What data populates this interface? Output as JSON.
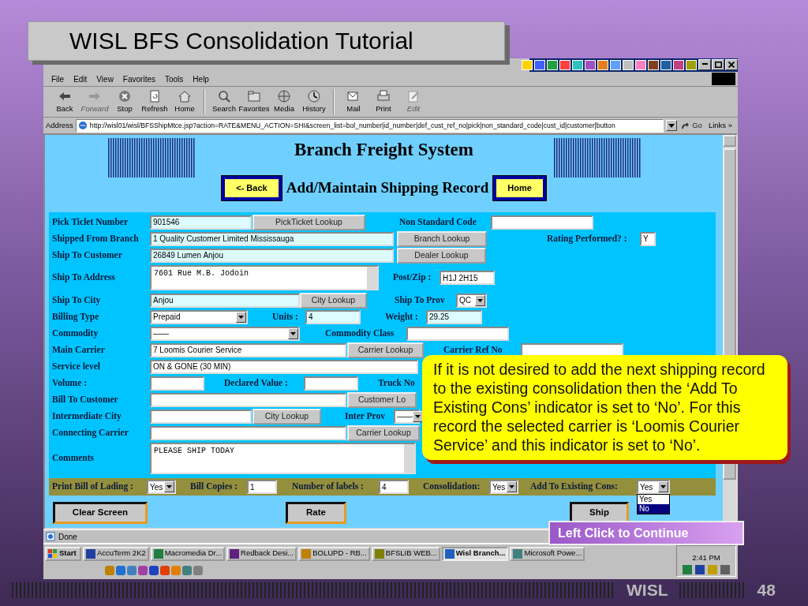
{
  "slide": {
    "title": "WISL BFS Consolidation Tutorial",
    "brand": "WISL",
    "page_number": "48"
  },
  "browser": {
    "menu": [
      "File",
      "Edit",
      "View",
      "Favorites",
      "Tools",
      "Help"
    ],
    "toolbar": [
      {
        "label": "Back",
        "disabled": false
      },
      {
        "label": "Forward",
        "disabled": true
      },
      {
        "label": "Stop",
        "disabled": false
      },
      {
        "label": "Refresh",
        "disabled": false
      },
      {
        "label": "Home",
        "disabled": false
      },
      {
        "label": "Search",
        "disabled": false
      },
      {
        "label": "Favorites",
        "disabled": false
      },
      {
        "label": "Media",
        "disabled": false
      },
      {
        "label": "History",
        "disabled": false
      },
      {
        "label": "Mail",
        "disabled": false
      },
      {
        "label": "Print",
        "disabled": false
      },
      {
        "label": "Edit",
        "disabled": true
      }
    ],
    "address_label": "Address",
    "url": "http://wisl01/wisl/BFSShipMtce.jsp?action=RATE&MENU_ACTION=SHI&screen_list=bol_number|id_number|def_cust_ref_no|pick|non_standard_code|cust_id|customer|button",
    "go": "Go",
    "links": "Links »",
    "status": "Done"
  },
  "page": {
    "title": "Branch Freight System",
    "subtitle": "Add/Maintain Shipping Record",
    "back": "<- Back",
    "home": "Home",
    "rows": [
      {
        "items": [
          {
            "kind": "label",
            "text": "Pick Ticlet Number"
          },
          {
            "kind": "input",
            "value": "901546",
            "readonly": true
          },
          {
            "kind": "button",
            "text": "PickTicket Lookup"
          },
          {
            "kind": "label",
            "text": "Non Standard Code"
          },
          {
            "kind": "input",
            "readonly": false
          }
        ]
      },
      {
        "items": [
          {
            "kind": "label",
            "text": "Shipped From Branch"
          },
          {
            "kind": "input",
            "value": "1 Quality Customer Limited Mississauga",
            "readonly": true
          },
          {
            "kind": "button",
            "text": "Branch Lookup"
          },
          {
            "kind": "label",
            "text": "Rating Performed? :"
          },
          {
            "kind": "input",
            "value": "Y",
            "readonly": false
          }
        ]
      },
      {
        "items": [
          {
            "kind": "label",
            "text": "Ship To Customer"
          },
          {
            "kind": "input",
            "value": "26849 Lumen Anjou",
            "readonly": true
          },
          {
            "kind": "button",
            "text": "Dealer Lookup"
          }
        ]
      },
      {
        "items": [
          {
            "kind": "label",
            "text": "Ship To Address"
          },
          {
            "kind": "textarea",
            "value": "7601 Rue M.B. Jodoin"
          },
          {
            "kind": "label",
            "text": "Post/Zip :"
          },
          {
            "kind": "input",
            "value": "H1J 2H15",
            "readonly": false
          }
        ]
      },
      {
        "items": [
          {
            "kind": "label",
            "text": "Ship To City"
          },
          {
            "kind": "input",
            "value": "Anjou",
            "readonly": true
          },
          {
            "kind": "button",
            "text": "City Lookup"
          },
          {
            "kind": "label",
            "text": "Ship To Prov"
          },
          {
            "kind": "select",
            "value": "QC"
          }
        ]
      },
      {
        "items": [
          {
            "kind": "label",
            "text": "Billing Type"
          },
          {
            "kind": "select",
            "value": "Prepaid"
          },
          {
            "kind": "label",
            "text": "Units :"
          },
          {
            "kind": "input",
            "value": "4",
            "readonly": true
          },
          {
            "kind": "label",
            "text": "Weight :"
          },
          {
            "kind": "input",
            "value": "29.25",
            "readonly": true
          }
        ]
      },
      {
        "items": [
          {
            "kind": "label",
            "text": "Commodity"
          },
          {
            "kind": "select",
            "value": "——"
          },
          {
            "kind": "label",
            "text": "Commodity Class"
          },
          {
            "kind": "input",
            "readonly": false
          }
        ]
      },
      {
        "items": [
          {
            "kind": "label",
            "text": "Main Carrier"
          },
          {
            "kind": "input",
            "value": "7 Loomis Courier Service",
            "readonly": false
          },
          {
            "kind": "button",
            "text": "Carrier Lookup"
          },
          {
            "kind": "label",
            "text": "Carrier Ref No"
          },
          {
            "kind": "input",
            "readonly": false
          }
        ]
      },
      {
        "items": [
          {
            "kind": "label",
            "text": "Service level"
          },
          {
            "kind": "input",
            "value": "ON & GONE (30 MIN)",
            "readonly": false
          }
        ]
      },
      {
        "items": [
          {
            "kind": "label",
            "text": "Volume :"
          },
          {
            "kind": "input",
            "readonly": false
          },
          {
            "kind": "label",
            "text": "Declared Value :"
          },
          {
            "kind": "input",
            "readonly": false
          },
          {
            "kind": "label",
            "text": "Truck No"
          }
        ]
      },
      {
        "items": [
          {
            "kind": "label",
            "text": "Bill To Customer"
          },
          {
            "kind": "input",
            "readonly": false
          },
          {
            "kind": "button",
            "text": "Customer Lo"
          }
        ]
      },
      {
        "items": [
          {
            "kind": "label",
            "text": "Intermediate City"
          },
          {
            "kind": "input",
            "readonly": false
          },
          {
            "kind": "button",
            "text": "City Lookup"
          },
          {
            "kind": "label",
            "text": "Inter Prov"
          },
          {
            "kind": "select",
            "value": "——"
          }
        ]
      },
      {
        "items": [
          {
            "kind": "label",
            "text": "Connecting Carrier"
          },
          {
            "kind": "input",
            "readonly": false
          },
          {
            "kind": "button",
            "text": "Carrier Lookup"
          }
        ]
      },
      {
        "items": [
          {
            "kind": "label",
            "text": "Comments"
          },
          {
            "kind": "textarea",
            "value": "PLEASE SHIP TODAY"
          }
        ]
      }
    ],
    "options_row": [
      {
        "kind": "label",
        "text": "Print Bill of Lading :"
      },
      {
        "kind": "select",
        "value": "Yes"
      },
      {
        "kind": "label",
        "text": "Bill Copies :"
      },
      {
        "kind": "input",
        "value": "1",
        "readonly": false
      },
      {
        "kind": "label",
        "text": "Number of labels :"
      },
      {
        "kind": "input",
        "value": "4",
        "readonly": false
      },
      {
        "kind": "label",
        "text": "Consolidation:"
      },
      {
        "kind": "select",
        "value": "Yes"
      },
      {
        "kind": "label",
        "text": "Add To Existing Cons:"
      },
      {
        "kind": "select",
        "value": "Yes"
      }
    ],
    "dropdown": [
      {
        "label": "Yes",
        "selected": false
      },
      {
        "label": "No",
        "selected": true
      }
    ],
    "actions": [
      "Clear Screen",
      "Rate",
      "Ship"
    ]
  },
  "taskbar": {
    "start": "Start",
    "tasks": [
      {
        "label": "AccuTerm 2K2",
        "selected": false
      },
      {
        "label": "Macromedia Dr...",
        "selected": false
      },
      {
        "label": "Redback Desi...",
        "selected": false
      },
      {
        "label": "BOLUPD - RB...",
        "selected": false
      },
      {
        "label": "BFSLIB   WEB...",
        "selected": false
      },
      {
        "label": "Wisl Branch...",
        "selected": true
      },
      {
        "label": "Microsoft Powe...",
        "selected": false
      }
    ],
    "clock": "2:41 PM"
  },
  "callout": "If it is not desired to add the next shipping record to the existing consolidation then the ‘Add To Existing Cons’  indicator is set to ‘No’. For this record the selected carrier is ‘Loomis Courier Service’ and this indicator is set to ‘No’.",
  "continue": "Left Click to Continue"
}
